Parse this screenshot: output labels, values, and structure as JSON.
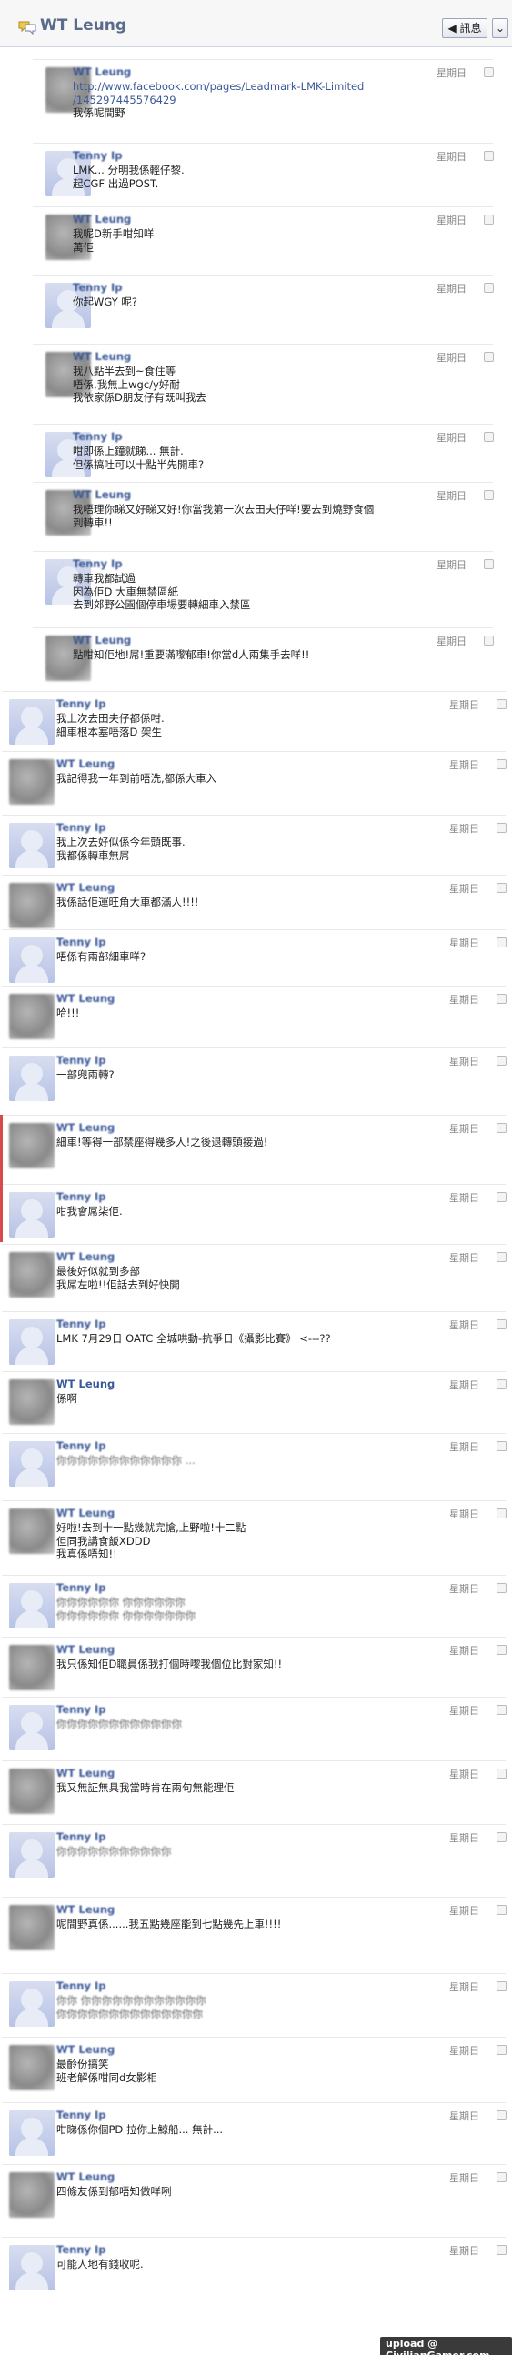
{
  "header": {
    "title": "WT Leung",
    "back_label": "◀ 訊息",
    "more_label": "⌄"
  },
  "messages": [
    {
      "sender": "WT Leung",
      "time": "星期日",
      "lines": [
        "http://www.facebook.com/pages/Leadmark-LMK-Limited",
        "/145297445576429",
        "我係呢間野"
      ],
      "link_lines": 2
    },
    {
      "sender": "Tenny Ip",
      "time": "星期日",
      "lines": [
        "LMK... 分明我係輕仔黎.",
        "起CGF 出過POST."
      ]
    },
    {
      "sender": "WT Leung",
      "time": "星期日",
      "lines": [
        "我呢D新手咁知咩",
        "萬佢"
      ]
    },
    {
      "sender": "Tenny Ip",
      "time": "星期日",
      "lines": [
        "你起WGY 呢?"
      ]
    },
    {
      "sender": "WT Leung",
      "time": "星期日",
      "lines": [
        "我八點半去到~食住等",
        "唔係,我無上wgc/y好耐",
        "我依家係D朋友仔有既叫我去"
      ]
    },
    {
      "sender": "Tenny Ip",
      "time": "星期日",
      "lines": [
        "咁即係上鐘就睇... 無計.",
        "但係搞吐可以十點半先開車?"
      ]
    },
    {
      "sender": "WT Leung",
      "time": "星期日",
      "lines": [
        "我唔理你睇又好睇又好!你當我第一次去田夫仔咩!要去到燒野食個",
        "到轉車!!"
      ]
    },
    {
      "sender": "Tenny Ip",
      "time": "星期日",
      "lines": [
        "轉車我都試過",
        "因為佢D 大車無禁區紙",
        "去到郊野公園個停車場要轉細車入禁區"
      ]
    },
    {
      "sender": "WT Leung",
      "time": "星期日",
      "lines": [
        "點咁知佢地!屌!重要滿嚟郁車!你當d人兩集手去咩!!"
      ]
    },
    {
      "sender": "Tenny Ip",
      "time": "星期日",
      "lines": [
        "我上次去田夫仔都係咁.",
        "細車根本塞唔落D 架生"
      ]
    },
    {
      "sender": "WT Leung",
      "time": "星期日",
      "lines": [
        "我記得我一年到前唔洗,都係大車入"
      ]
    },
    {
      "sender": "Tenny Ip",
      "time": "星期日",
      "lines": [
        "我上次去好似係今年頭既事.",
        "我都係轉車無屌"
      ]
    },
    {
      "sender": "WT Leung",
      "time": "星期日",
      "lines": [
        "我係話佢運旺角大車都滿人!!!!"
      ]
    },
    {
      "sender": "Tenny Ip",
      "time": "星期日",
      "lines": [
        "唔係有兩部細車咩?"
      ]
    },
    {
      "sender": "WT Leung",
      "time": "星期日",
      "lines": [
        "哈!!!"
      ]
    },
    {
      "sender": "Tenny Ip",
      "time": "星期日",
      "lines": [
        "一部兜兩轉?"
      ]
    },
    {
      "sender": "WT Leung",
      "time": "星期日",
      "lines": [
        "細車!等得一部禁座得幾多人!之後退轉頭接過!"
      ]
    },
    {
      "sender": "Tenny Ip",
      "time": "星期日",
      "lines": [
        "咁我會屌柒佢."
      ]
    },
    {
      "sender": "WT Leung",
      "time": "星期日",
      "lines": [
        "最後好似就到多部",
        "我屌左啦!!佢話去到好快開"
      ]
    },
    {
      "sender": "Tenny Ip",
      "time": "星期日",
      "lines": [
        "LMK 7月29日 OATC 全城哄動-抗爭日《攝影比賽》 <---??"
      ]
    },
    {
      "sender": "WT Leung",
      "time": "星期日",
      "lines": [
        "係啊"
      ],
      "name_clear": true
    },
    {
      "sender": "Tenny Ip",
      "time": "星期日",
      "lines": [
        "你你你你你你你你你你你你 ..."
      ],
      "blur_body": true
    },
    {
      "sender": "WT Leung",
      "time": "星期日",
      "lines": [
        "好啦!去到十一點幾就完搶,上野啦!十二點",
        "但同我講食飯XDDD",
        "我真係唔知!!"
      ]
    },
    {
      "sender": "Tenny Ip",
      "time": "星期日",
      "lines": [
        "你你你你你你 你你你你你你",
        "你你你你你你 你你你你你你你"
      ],
      "blur_body": true
    },
    {
      "sender": "WT Leung",
      "time": "星期日",
      "lines": [
        "我只係知佢D職員係我打個時嚟我個位比對家知!!"
      ]
    },
    {
      "sender": "Tenny Ip",
      "time": "星期日",
      "lines": [
        "你你你你你你你你你你你你"
      ],
      "blur_body": true
    },
    {
      "sender": "WT Leung",
      "time": "星期日",
      "lines": [
        "我又無証無具我當時肯在兩句無能理佢"
      ]
    },
    {
      "sender": "Tenny Ip",
      "time": "星期日",
      "lines": [
        "你你你你你你你你你你你"
      ],
      "blur_body": true
    },
    {
      "sender": "WT Leung",
      "time": "星期日",
      "lines": [
        "呢間野真係......我五點幾座能到七點幾先上車!!!!"
      ]
    },
    {
      "sender": "Tenny Ip",
      "time": "星期日",
      "lines": [
        "你你 你你你你你你你你你你你你",
        "你你你你你你你你你你你你你你"
      ],
      "blur_body": true
    },
    {
      "sender": "WT Leung",
      "time": "星期日",
      "lines": [
        "最齡份搞笑",
        "班老解係咁同d女影相"
      ]
    },
    {
      "sender": "Tenny Ip",
      "time": "星期日",
      "lines": [
        "咁睇係你個PD 拉你上鯨船... 無計..."
      ]
    },
    {
      "sender": "WT Leung",
      "time": "星期日",
      "lines": [
        "四條友係到郁唔知做咩咧"
      ]
    },
    {
      "sender": "Tenny Ip",
      "time": "星期日",
      "lines": [
        "可能人地有錢收呢."
      ]
    }
  ],
  "watermark": "upload @ CivilianGamer.com"
}
